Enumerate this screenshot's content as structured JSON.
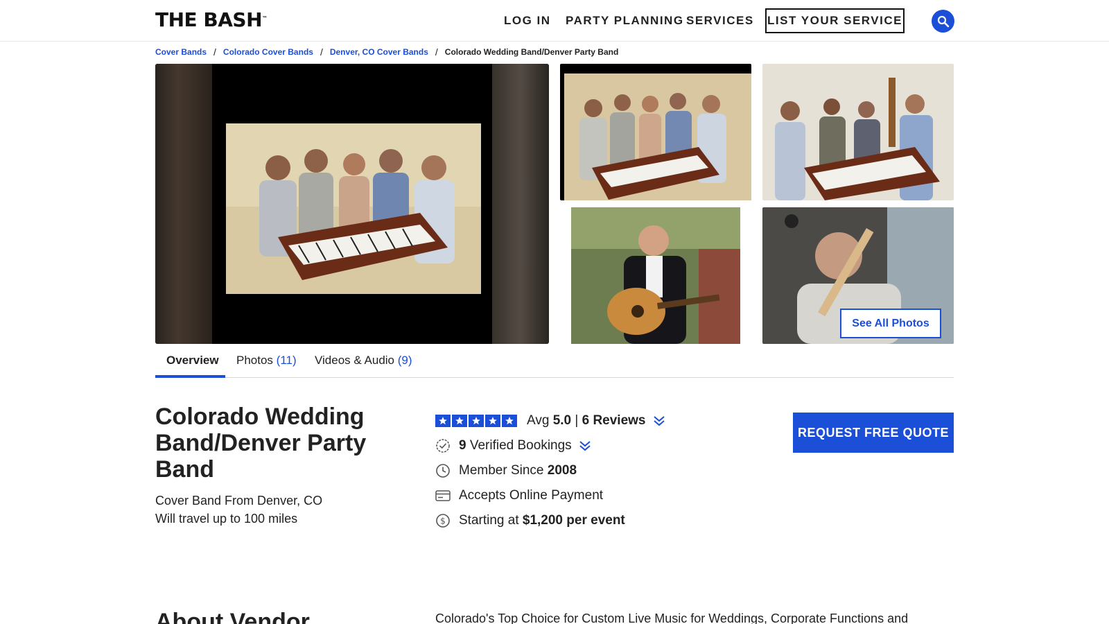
{
  "brand": {
    "logo_text": "THE BASH",
    "logo_mark": "™"
  },
  "nav": {
    "login": "LOG IN",
    "party_planning": "PARTY PLANNING",
    "services": "SERVICES",
    "list_service": "LIST YOUR SERVICE"
  },
  "breadcrumb": {
    "items": [
      "Cover Bands",
      "Colorado Cover Bands",
      "Denver, CO Cover Bands"
    ],
    "current": "Colorado Wedding Band/Denver Party Band",
    "separator": "/"
  },
  "gallery": {
    "see_all": "See All Photos"
  },
  "tabs": {
    "overview": "Overview",
    "photos_label": "Photos",
    "photos_count": "(11)",
    "videos_label": "Videos & Audio",
    "videos_count": "(9)"
  },
  "vendor": {
    "title": "Colorado Wedding Band/Denver Party Band",
    "category": "Cover Band From Denver, CO",
    "travel": "Will travel up to 100 miles"
  },
  "stats": {
    "avg_label": "Avg",
    "avg_value": "5.0",
    "divider": "|",
    "reviews": "6 Reviews",
    "bookings_count": "9",
    "bookings_label": "Verified Bookings",
    "member_label": "Member Since",
    "member_year": "2008",
    "payment": "Accepts Online Payment",
    "price_label": "Starting at",
    "price_value": "$1,200 per event",
    "rating_fraction": 1.0
  },
  "cta": {
    "quote": "REQUEST FREE QUOTE"
  },
  "about": {
    "heading": "About Vendor",
    "text": "Colorado's Top Choice for Custom Live Music for Weddings, Corporate Functions and"
  },
  "colors": {
    "accent": "#1b4fd8",
    "text": "#222222"
  }
}
